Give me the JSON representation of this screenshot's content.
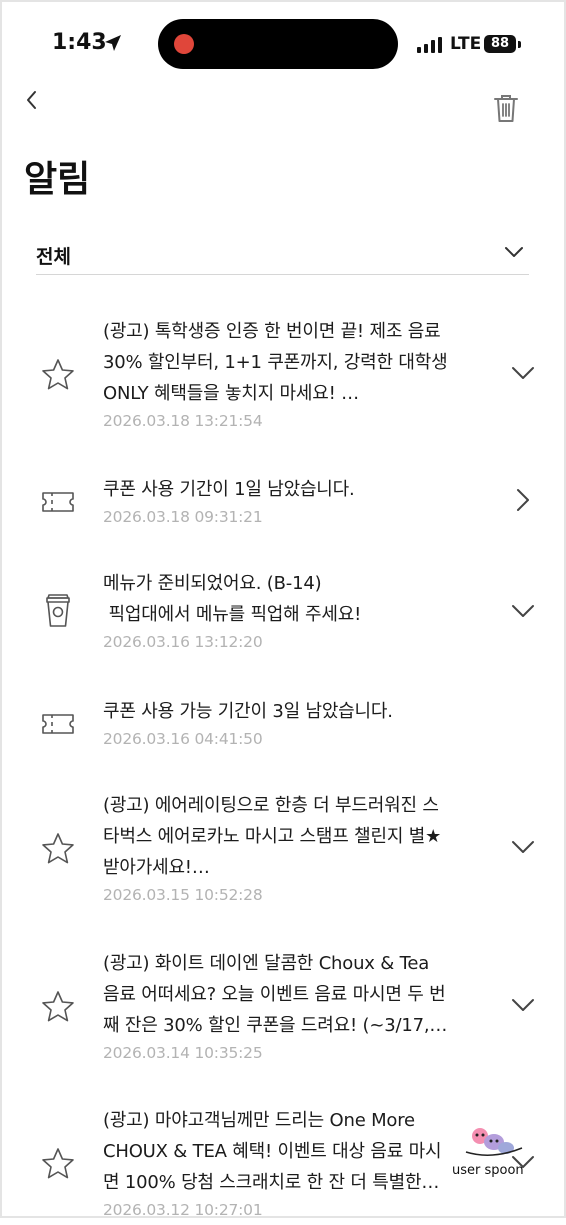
{
  "status": {
    "time": "1:43",
    "network": "LTE",
    "battery": "88"
  },
  "header": {
    "title": "알림"
  },
  "filter": {
    "label": "전체"
  },
  "notifications": [
    {
      "icon": "star-icon",
      "lines": [
        "(광고) 톡학생증 인증 한 번이면 끝! 제조 음료",
        "30% 할인부터, 1+1 쿠폰까지, 강력한 대학생",
        "ONLY 혜택들을 놓치지 마세요! …"
      ],
      "date": "2026.03.18 13:21:54",
      "action": "chevron-down-icon"
    },
    {
      "icon": "coupon-icon",
      "lines": [
        "쿠폰 사용 기간이 1일 남았습니다."
      ],
      "date": "2026.03.18 09:31:21",
      "action": "chevron-right-icon"
    },
    {
      "icon": "cup-icon",
      "lines": [
        "메뉴가 준비되었어요. (B-14)",
        " 픽업대에서 메뉴를 픽업해 주세요!"
      ],
      "date": "2026.03.16 13:12:20",
      "action": "chevron-down-icon"
    },
    {
      "icon": "coupon-icon",
      "lines": [
        "쿠폰 사용 가능 기간이 3일 남았습니다."
      ],
      "date": "2026.03.16 04:41:50",
      "action": ""
    },
    {
      "icon": "star-icon",
      "lines": [
        "(광고) 에어레이팅으로 한층 더 부드러워진 스",
        "타벅스 에어로카노 마시고 스탬프 챌린지 별★",
        "받아가세요!…"
      ],
      "date": "2026.03.15 10:52:28",
      "action": "chevron-down-icon"
    },
    {
      "icon": "star-icon",
      "lines": [
        "(광고) 화이트 데이엔 달콤한 Choux & Tea",
        "음료 어떠세요? 오늘 이벤트 음료 마시면 두 번",
        "째 잔은 30% 할인 쿠폰을 드려요! (~3/17,…"
      ],
      "date": "2026.03.14 10:35:25",
      "action": "chevron-down-icon"
    },
    {
      "icon": "star-icon",
      "lines": [
        "(광고) 마야고객님께만 드리는 One More",
        "CHOUX & TEA 혜택! 이벤트 대상 음료 마시",
        "면 100% 당첨 스크래치로 한 잔 더 특별한…"
      ],
      "date": "2026.03.12 10:27:01",
      "action": "chevron-down-icon"
    }
  ],
  "watermark": {
    "text": "user spoon"
  }
}
